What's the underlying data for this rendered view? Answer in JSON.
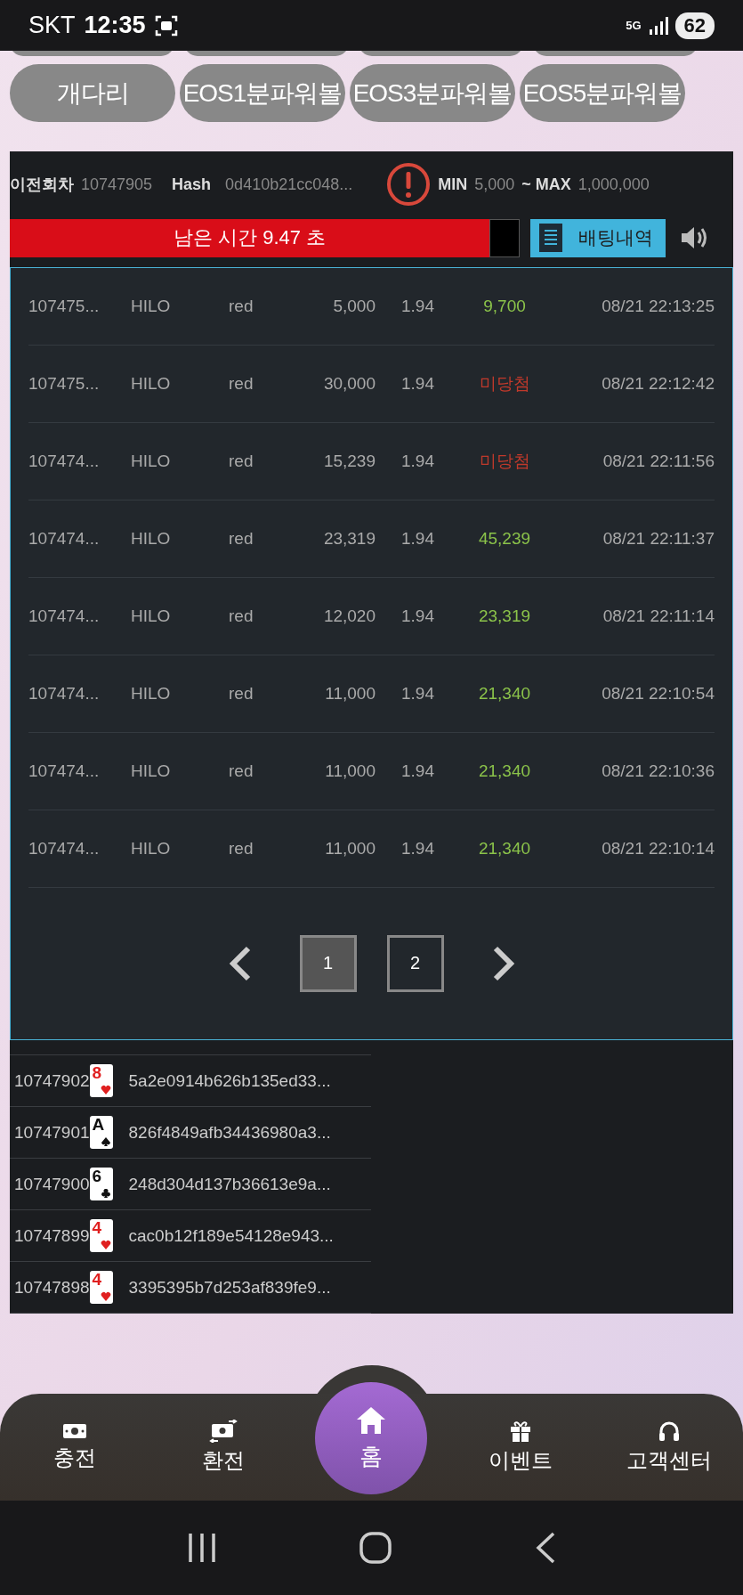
{
  "status_bar": {
    "carrier": "SKT",
    "time": "12:35",
    "network": "5G",
    "battery": "62"
  },
  "category_buttons": [
    {
      "label": "개다리"
    },
    {
      "label": "EOS1분파워볼"
    },
    {
      "label": "EOS3분파워볼"
    },
    {
      "label": "EOS5분파워볼"
    }
  ],
  "game_header": {
    "prev_round_label": "이전회차",
    "prev_round": "10747905",
    "hash_label": "Hash",
    "hash": "0d410b21cc048...",
    "min_label": "MIN",
    "min": "5,000",
    "max_label": "~ MAX",
    "max": "1,000,000"
  },
  "timer": {
    "text": "남은 시간 9.47 초",
    "history_button": "배팅내역"
  },
  "bet_history": {
    "rows": [
      {
        "round": "107475...",
        "game": "HILO",
        "pick": "red",
        "amount": "5,000",
        "odds": "1.94",
        "result": "9,700",
        "kind": "win",
        "time": "08/21 22:13:25"
      },
      {
        "round": "107475...",
        "game": "HILO",
        "pick": "red",
        "amount": "30,000",
        "odds": "1.94",
        "result": "미당첨",
        "kind": "lose",
        "time": "08/21 22:12:42"
      },
      {
        "round": "107474...",
        "game": "HILO",
        "pick": "red",
        "amount": "15,239",
        "odds": "1.94",
        "result": "미당첨",
        "kind": "lose",
        "time": "08/21 22:11:56"
      },
      {
        "round": "107474...",
        "game": "HILO",
        "pick": "red",
        "amount": "23,319",
        "odds": "1.94",
        "result": "45,239",
        "kind": "win",
        "time": "08/21 22:11:37"
      },
      {
        "round": "107474...",
        "game": "HILO",
        "pick": "red",
        "amount": "12,020",
        "odds": "1.94",
        "result": "23,319",
        "kind": "win",
        "time": "08/21 22:11:14"
      },
      {
        "round": "107474...",
        "game": "HILO",
        "pick": "red",
        "amount": "11,000",
        "odds": "1.94",
        "result": "21,340",
        "kind": "win",
        "time": "08/21 22:10:54"
      },
      {
        "round": "107474...",
        "game": "HILO",
        "pick": "red",
        "amount": "11,000",
        "odds": "1.94",
        "result": "21,340",
        "kind": "win",
        "time": "08/21 22:10:36"
      },
      {
        "round": "107474...",
        "game": "HILO",
        "pick": "red",
        "amount": "11,000",
        "odds": "1.94",
        "result": "21,340",
        "kind": "win",
        "time": "08/21 22:10:14"
      }
    ],
    "pages": [
      {
        "label": "1",
        "selected": true
      },
      {
        "label": "2",
        "selected": false
      }
    ]
  },
  "results": [
    {
      "round": "10747902",
      "rank": "8",
      "kind": "heart",
      "hash": "5a2e0914b626b135ed33..."
    },
    {
      "round": "10747901",
      "rank": "A",
      "kind": "spade",
      "hash": "826f4849afb34436980a3..."
    },
    {
      "round": "10747900",
      "rank": "6",
      "kind": "club",
      "hash": "248d304d137b36613e9a..."
    },
    {
      "round": "10747899",
      "rank": "4",
      "kind": "heart",
      "hash": "cac0b12f189e54128e943..."
    },
    {
      "round": "10747898",
      "rank": "4",
      "kind": "heart",
      "hash": "3395395b7d253af839fe9..."
    }
  ],
  "bottom_nav": [
    {
      "label": "충전",
      "kind": "charge"
    },
    {
      "label": "환전",
      "kind": "exchange"
    },
    {
      "label": "홈",
      "kind": "home"
    },
    {
      "label": "이벤트",
      "kind": "event"
    },
    {
      "label": "고객센터",
      "kind": "support"
    }
  ]
}
